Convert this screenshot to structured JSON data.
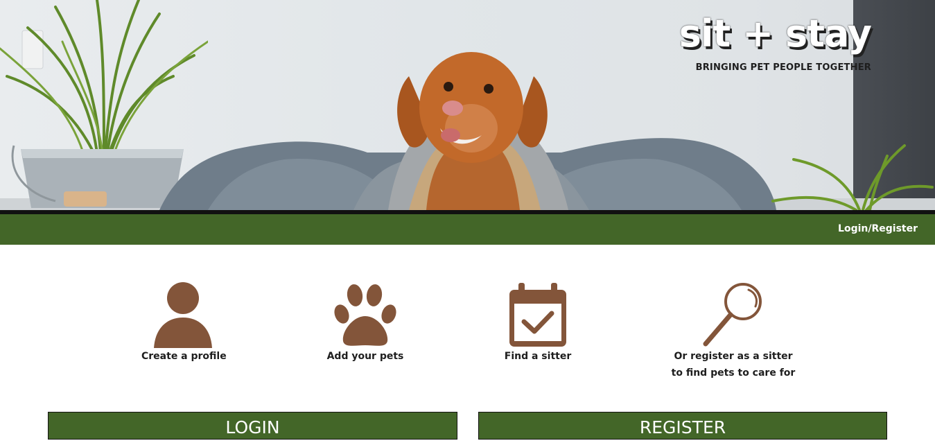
{
  "brand": {
    "logo": "sit + stay",
    "tagline": "BRINGING PET PEOPLE TOGETHER"
  },
  "nav": {
    "login_register": "Login/Register"
  },
  "steps": [
    {
      "icon": "person-icon",
      "label": "Create a profile"
    },
    {
      "icon": "paw-icon",
      "label": "Add your pets"
    },
    {
      "icon": "calendar-check-icon",
      "label": "Find a sitter"
    },
    {
      "icon": "magnifier-icon",
      "label_line1": "Or register as a sitter",
      "label_line2": "to find pets to care for"
    }
  ],
  "panels": {
    "login_title": "LOGIN",
    "register_title": "REGISTER"
  },
  "colors": {
    "nav_green": "#436628",
    "icon_brown": "#83553a",
    "text_dark": "#1e1e1e"
  }
}
